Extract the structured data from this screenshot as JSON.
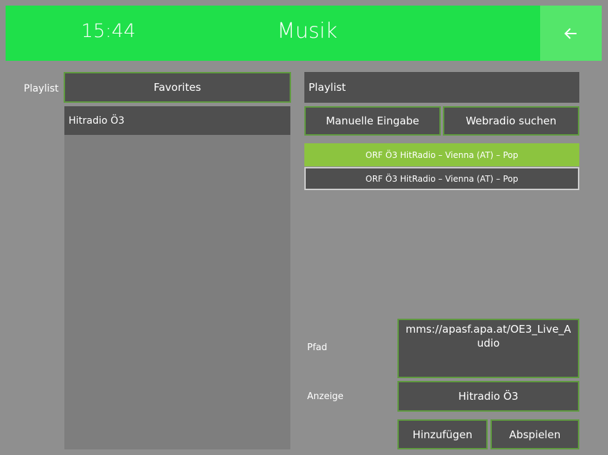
{
  "header": {
    "time": "15:44",
    "title": "Musik",
    "back_icon": "arrow-left-icon"
  },
  "left": {
    "playlist_label": "Playlist",
    "playlist_selected": "Favorites",
    "items": [
      "Hitradio Ö3"
    ]
  },
  "right": {
    "playlist_label": "Playlist",
    "manual_button": "Manuelle Eingabe",
    "search_button": "Webradio suchen",
    "results": [
      {
        "text": "ORF Ö3 HitRadio – Vienna (AT) – Pop",
        "selected": true
      },
      {
        "text": "ORF Ö3 HitRadio – Vienna (AT) – Pop",
        "selected": false
      }
    ],
    "path_label": "Pfad",
    "path_value": "mms://apasf.apa.at/OE3_Live_Audio",
    "display_label": "Anzeige",
    "display_value": "Hitradio Ö3",
    "add_button": "Hinzufügen",
    "play_button": "Abspielen"
  },
  "colors": {
    "header_green": "#1fe04a",
    "back_green": "#54e66a",
    "selected_green": "#8cc43f"
  }
}
